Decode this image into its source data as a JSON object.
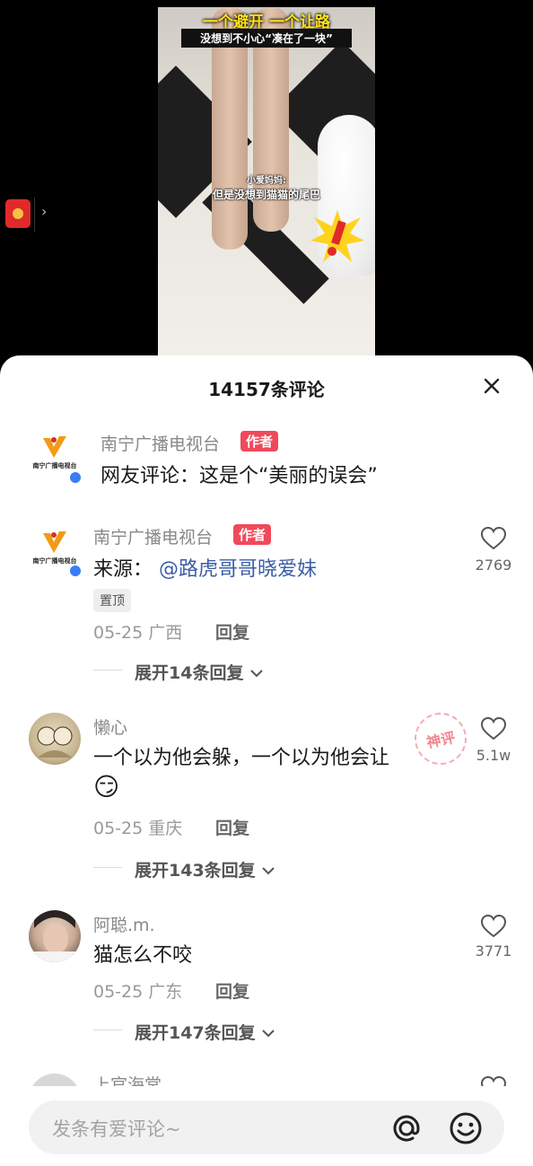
{
  "video": {
    "caption_top": "一个避开 一个让路",
    "caption_sub": "没想到不小心“凑在了一块”",
    "speaker_name": "小爱妈妈:",
    "speaker_line": "但是没想到猫猫的尾巴"
  },
  "side": {
    "redpacket_icon": "red-packet-icon",
    "chevron": "›"
  },
  "comments_header": {
    "title": "14157条评论",
    "close_icon": "close-icon"
  },
  "author_note": {
    "name": "南宁广播电视台",
    "tag": "作者",
    "text": "网友评论：这是个“美丽的误会”"
  },
  "comments": [
    {
      "name": "南宁广播电视台",
      "tag": "作者",
      "text_prefix": "来源：",
      "mention": "@路虎哥哥晓爱妹",
      "pinned": "置顶",
      "date_loc": "05-25 广西",
      "reply": "回复",
      "expand": "展开14条回复",
      "likes": "2769"
    },
    {
      "name": "懒心",
      "text": "一个以为他会躲，一个以为他会让",
      "emoji": "😏",
      "stamp": "神评",
      "date_loc": "05-25 重庆",
      "reply": "回复",
      "expand": "展开143条回复",
      "likes": "5.1w"
    },
    {
      "name": "阿聪.m.",
      "text": "猫怎么不咬",
      "date_loc": "05-25 广东",
      "reply": "回复",
      "expand": "展开147条回复",
      "likes": "3771"
    },
    {
      "name": "上官海棠"
    }
  ],
  "composer": {
    "placeholder": "发条有爱评论~",
    "at_icon": "at-icon",
    "emoji_icon": "emoji-icon"
  },
  "colors": {
    "author_tag": "#f0495b",
    "mention": "#3b5da8",
    "verified": "#3a7cf5"
  }
}
